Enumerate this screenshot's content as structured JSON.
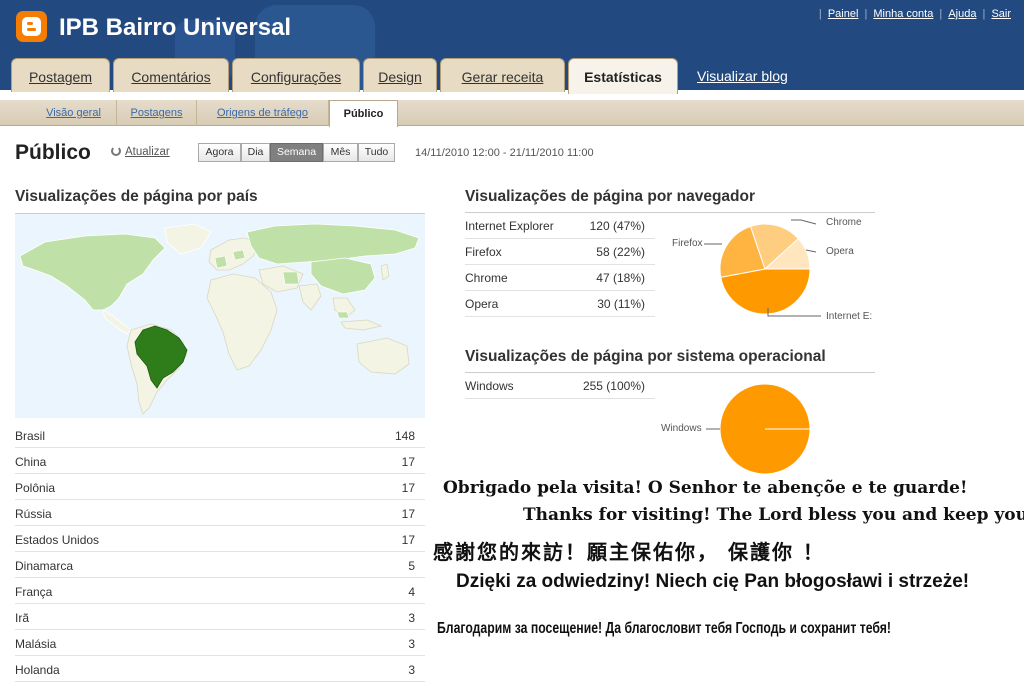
{
  "header": {
    "blog_title": "IPB Bairro Universal",
    "links": [
      "Painel",
      "Minha conta",
      "Ajuda",
      "Sair"
    ],
    "link_separator": "|"
  },
  "tabs": [
    "Postagem",
    "Comentários",
    "Configurações",
    "Design",
    "Gerar receita",
    "Estatísticas"
  ],
  "active_tab": "Estatísticas",
  "view_blog": "Visualizar blog",
  "subtabs": [
    "Visão geral",
    "Postagens",
    "Origens de tráfego",
    "Público"
  ],
  "active_subtab": "Público",
  "page": {
    "title": "Público",
    "refresh": "Atualizar",
    "ranges": [
      "Agora",
      "Dia",
      "Semana",
      "Mês",
      "Tudo"
    ],
    "active_range": "Semana",
    "date_range": "14/11/2010 12:00 - 21/11/2010 11:00"
  },
  "countries": {
    "title": "Visualizações de página por país",
    "highlight_color": "#2f7d1a",
    "rows": [
      {
        "name": "Brasil",
        "value": "148"
      },
      {
        "name": "China",
        "value": "17"
      },
      {
        "name": "Polônia",
        "value": "17"
      },
      {
        "name": "Rússia",
        "value": "17"
      },
      {
        "name": "Estados Unidos",
        "value": "17"
      },
      {
        "name": "Dinamarca",
        "value": "5"
      },
      {
        "name": "França",
        "value": "4"
      },
      {
        "name": "Irã",
        "value": "3"
      },
      {
        "name": "Malásia",
        "value": "3"
      },
      {
        "name": "Holanda",
        "value": "3"
      }
    ]
  },
  "browsers": {
    "title": "Visualizações de página por navegador",
    "rows": [
      {
        "name": "Internet Explorer",
        "value": "120 (47%)"
      },
      {
        "name": "Firefox",
        "value": "58 (22%)"
      },
      {
        "name": "Chrome",
        "value": "47 (18%)"
      },
      {
        "name": "Opera",
        "value": "30 (11%)"
      }
    ],
    "pie_labels": {
      "chrome": "Chrome",
      "firefox": "Firefox",
      "opera": "Opera",
      "ie": "Internet E:"
    }
  },
  "os": {
    "title": "Visualizações de página por sistema operacional",
    "rows": [
      {
        "name": "Windows",
        "value": "255 (100%)"
      }
    ],
    "pie_label": "Windows"
  },
  "chart_data": [
    {
      "type": "pie",
      "categories": [
        "Internet Explorer",
        "Firefox",
        "Chrome",
        "Opera"
      ],
      "values": [
        120,
        58,
        47,
        30
      ],
      "colors": [
        "#ff9900",
        "#ffb442",
        "#ffcd80",
        "#ffe6bf"
      ]
    },
    {
      "type": "pie",
      "categories": [
        "Windows"
      ],
      "values": [
        255
      ],
      "colors": [
        "#ff9900"
      ]
    }
  ],
  "messages": [
    "Obrigado pela visita! O Senhor te abençõe e te guarde!",
    "Thanks for visiting! The Lord bless you and keep you!",
    "感謝您的來訪！願主保佑你， 保護你 ！",
    "Dzięki za odwiedziny! Niech cię Pan błogosławi i strzeże!",
    "Благодарим за посещение! Да благословит тебя Господь и сохранит тебя!"
  ],
  "colors": {
    "header_bg": "#234a80",
    "accent_orange": "#f57d00",
    "link_blue": "#3b6aa8"
  }
}
